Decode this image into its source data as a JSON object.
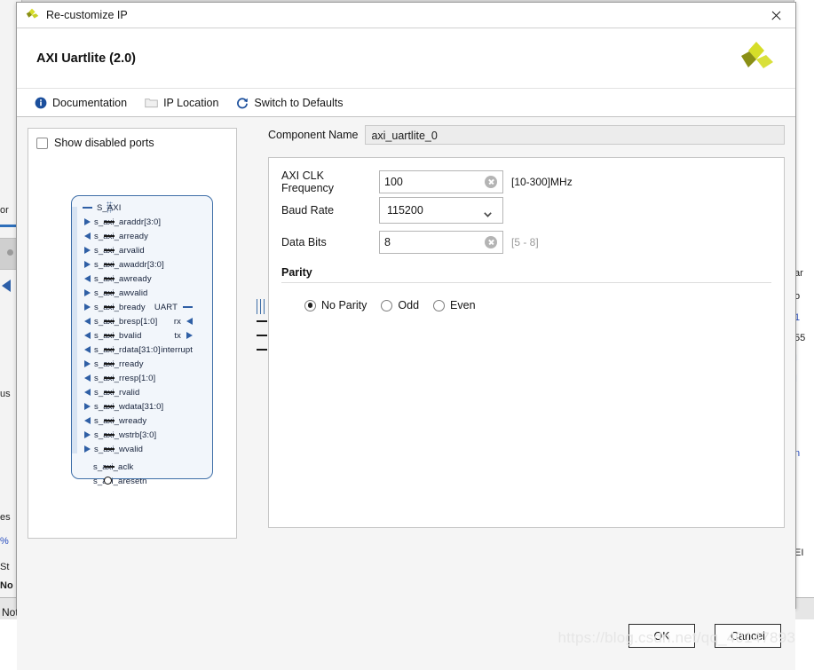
{
  "window": {
    "title": "Re-customize IP",
    "app_icon": "xilinx-logo-icon",
    "close_icon": "close-icon"
  },
  "header": {
    "title": "AXI Uartlite (2.0)",
    "logo_icon": "xilinx-logo-icon"
  },
  "toolbar": {
    "items": [
      {
        "label": "Documentation",
        "icon": "info-icon"
      },
      {
        "label": "IP Location",
        "icon": "folder-icon"
      },
      {
        "label": "Switch to Defaults",
        "icon": "refresh-icon"
      }
    ]
  },
  "ports_panel": {
    "show_disabled_label": "Show disabled ports",
    "show_disabled_checked": false,
    "block": {
      "bus_group_label": "S_AXI",
      "left_ports": [
        {
          "name": "s_axi_araddr[3:0]",
          "dir": "in"
        },
        {
          "name": "s_axi_arready",
          "dir": "out"
        },
        {
          "name": "s_axi_arvalid",
          "dir": "in"
        },
        {
          "name": "s_axi_awaddr[3:0]",
          "dir": "in"
        },
        {
          "name": "s_axi_awready",
          "dir": "out"
        },
        {
          "name": "s_axi_awvalid",
          "dir": "in"
        },
        {
          "name": "s_axi_bready",
          "dir": "in"
        },
        {
          "name": "s_axi_bresp[1:0]",
          "dir": "out"
        },
        {
          "name": "s_axi_bvalid",
          "dir": "out"
        },
        {
          "name": "s_axi_rdata[31:0]",
          "dir": "out"
        },
        {
          "name": "s_axi_rready",
          "dir": "in"
        },
        {
          "name": "s_axi_rresp[1:0]",
          "dir": "out"
        },
        {
          "name": "s_axi_rvalid",
          "dir": "out"
        },
        {
          "name": "s_axi_wdata[31:0]",
          "dir": "in"
        },
        {
          "name": "s_axi_wready",
          "dir": "out"
        },
        {
          "name": "s_axi_wstrb[3:0]",
          "dir": "in"
        },
        {
          "name": "s_axi_wvalid",
          "dir": "in"
        }
      ],
      "clock_ports": [
        {
          "name": "s_axi_aclk",
          "dir": "clock"
        },
        {
          "name": "s_axi_aresetn",
          "dir": "reset"
        }
      ],
      "right_ports": [
        {
          "name": "UART",
          "dir": "bus"
        },
        {
          "name": "rx",
          "dir": "in"
        },
        {
          "name": "tx",
          "dir": "out"
        },
        {
          "name": "interrupt",
          "dir": "out"
        }
      ]
    }
  },
  "config": {
    "component_name_label": "Component Name",
    "component_name_value": "axi_uartlite_0",
    "fields": [
      {
        "label": "AXI CLK Frequency",
        "value": "100",
        "hint": "[10-300]MHz",
        "hint_muted": false,
        "kind": "text",
        "clearable": true
      },
      {
        "label": "Baud Rate",
        "value": "115200",
        "hint": "",
        "hint_muted": false,
        "kind": "select",
        "clearable": false
      },
      {
        "label": "Data Bits",
        "value": "8",
        "hint": "[5 - 8]",
        "hint_muted": true,
        "kind": "text",
        "clearable": true
      }
    ],
    "parity": {
      "title": "Parity",
      "options": [
        {
          "label": "No Parity",
          "selected": true
        },
        {
          "label": "Odd",
          "selected": false
        },
        {
          "label": "Even",
          "selected": false
        }
      ]
    }
  },
  "footer": {
    "ok_label": "OK",
    "cancel_label": "Cancel"
  },
  "background": {
    "watermark": "https://blog.csdn.net/qq_40147893",
    "status_text": "Not started",
    "left_fragments": [
      "or",
      "us",
      "es",
      "%",
      "St",
      "No"
    ],
    "right_fragments": [
      "ar",
      "o",
      "1",
      "55",
      "I",
      "I",
      "n",
      "EI",
      "893"
    ]
  },
  "colors": {
    "accent_blue": "#2f5fa5",
    "block_fill": "#f2f6fb",
    "logo_yellow": "#d6dd28",
    "logo_olive": "#8a8f15",
    "dialog_bg": "#f5f5f5"
  }
}
